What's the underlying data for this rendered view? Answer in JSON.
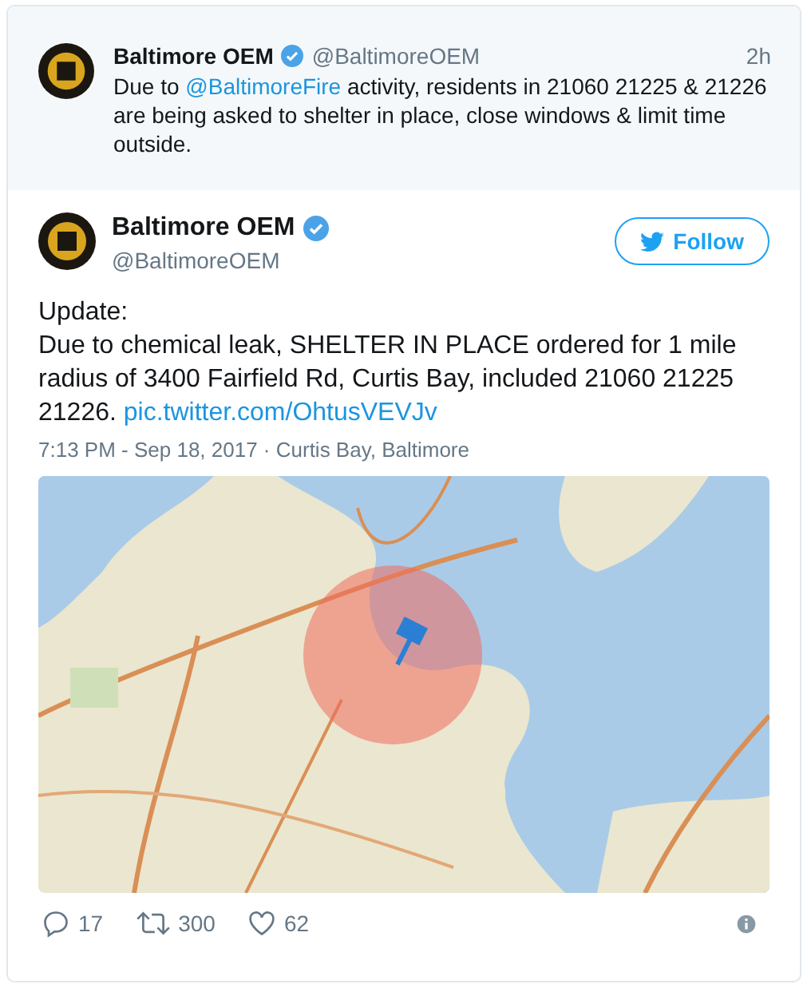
{
  "parent_tweet": {
    "name": "Baltimore OEM",
    "verified": true,
    "handle": "@BaltimoreOEM",
    "time": "2h",
    "text": [
      {
        "kind": "text",
        "text": "Due to "
      },
      {
        "kind": "link",
        "text": "@BaltimoreFire"
      },
      {
        "kind": "text",
        "text": " activity, residents in 21060 21225 & 21226 are being asked to shelter in place, close windows & limit time outside."
      }
    ]
  },
  "tweet": {
    "name": "Baltimore OEM",
    "verified": true,
    "handle": "@BaltimoreOEM",
    "follow_button": "Follow",
    "text_lines": [
      [
        {
          "kind": "text",
          "text": "Update:"
        }
      ],
      [
        {
          "kind": "text",
          "text": "Due to chemical leak, SHELTER IN PLACE ordered for 1 mile radius of 3400 Fairfield Rd, Curtis Bay, included 21060 21225 21226. "
        },
        {
          "kind": "link",
          "text": "pic.twitter.com/OhtusVEVJv"
        }
      ]
    ],
    "meta": "7:13 PM - Sep 18, 2017 · Curtis Bay, Baltimore",
    "media": {
      "kind": "picture"
    },
    "actions": [
      {
        "kind": "reply",
        "count": "17"
      },
      {
        "kind": "retweet",
        "count": "300"
      },
      {
        "kind": "like",
        "count": "62"
      }
    ]
  }
}
